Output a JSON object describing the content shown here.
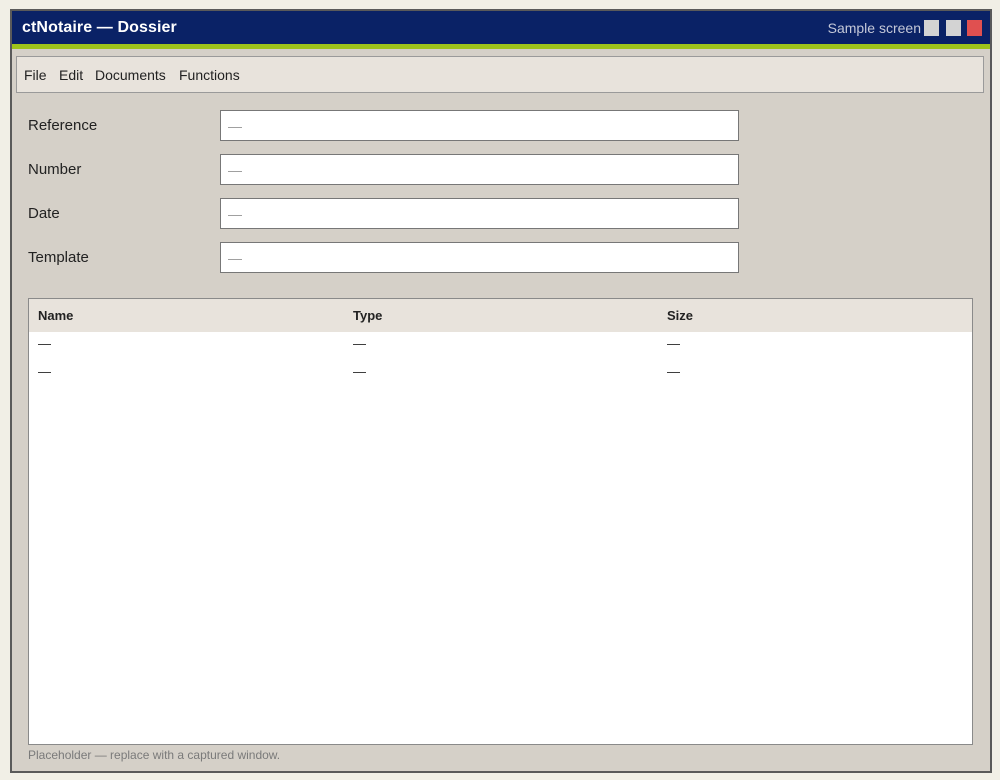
{
  "window": {
    "title": "ctNotaire — Dossier",
    "sample_label": "Sample screen"
  },
  "menu": {
    "items": [
      "File",
      "Edit",
      "Documents",
      "Functions"
    ]
  },
  "form": {
    "fields": [
      {
        "label": "Reference",
        "placeholder": "—"
      },
      {
        "label": "Number",
        "placeholder": "—"
      },
      {
        "label": "Date",
        "placeholder": "—"
      },
      {
        "label": "Template",
        "placeholder": "—"
      }
    ]
  },
  "table": {
    "columns": [
      "Name",
      "Type",
      "Size"
    ],
    "rows": [
      [
        "—",
        "—",
        "—"
      ],
      [
        "—",
        "—",
        "—"
      ]
    ]
  },
  "footer": {
    "note": "Placeholder — replace with a captured window."
  },
  "colors": {
    "titlebar": "#0a2266",
    "accent": "#9ec41a",
    "close_button": "#e05050"
  }
}
